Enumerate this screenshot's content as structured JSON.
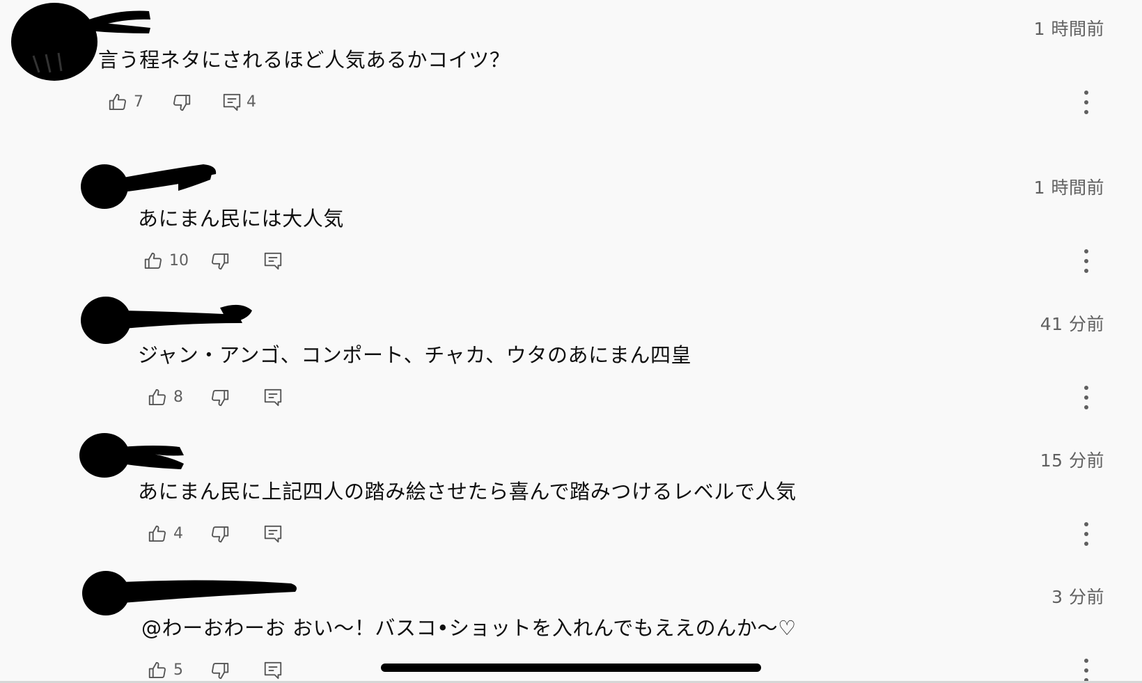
{
  "comments": [
    {
      "time": "1 時間前",
      "text": "言う程ネタにされるほど人気あるかコイツ？",
      "likes": "7",
      "replies": "4",
      "icons": [
        "thumb-up-icon",
        "thumb-down-icon",
        "reply-icon",
        "more-vert-icon"
      ]
    },
    {
      "time": "1 時間前",
      "text": "あにまん民には大人気",
      "likes": "10",
      "icons": [
        "thumb-up-icon",
        "thumb-down-icon",
        "reply-icon",
        "more-vert-icon"
      ]
    },
    {
      "time": "41 分前",
      "text": "ジャン・アンゴ、コンポート、チャカ、ウタのあにまん四皇",
      "likes": "8",
      "icons": [
        "thumb-up-icon",
        "thumb-down-icon",
        "reply-icon",
        "more-vert-icon"
      ]
    },
    {
      "time": "15 分前",
      "text": "あにまん民に上記四人の踏み絵させたら喜んで踏みつけるレベルで人気",
      "likes": "4",
      "icons": [
        "thumb-up-icon",
        "thumb-down-icon",
        "reply-icon",
        "more-vert-icon"
      ]
    },
    {
      "time": "3 分前",
      "text": "@わーおわーお  おい〜！バスコ•ショットを入れんでもええのんか〜♡",
      "likes": "5",
      "icons": [
        "thumb-up-icon",
        "thumb-down-icon",
        "reply-icon",
        "more-vert-icon"
      ]
    }
  ],
  "colors": {
    "background": "#f9f9f9",
    "text": "#0f0f0f",
    "secondary_text": "#606060",
    "redaction": "#000000"
  }
}
